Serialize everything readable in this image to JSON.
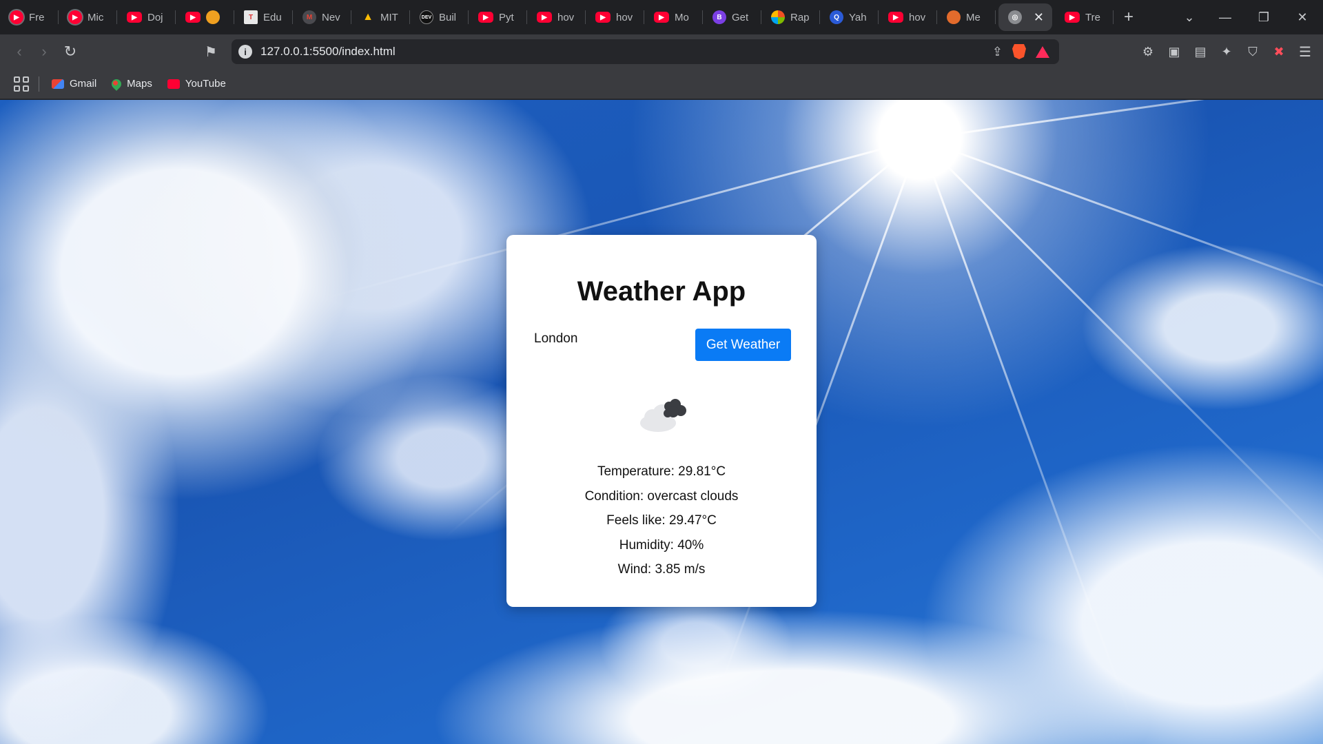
{
  "browser": {
    "tabs": [
      {
        "title": "Fre",
        "favicon": "youtube-icon"
      },
      {
        "title": "Mic",
        "favicon": "youtube-icon"
      },
      {
        "title": "Doj",
        "favicon": "youtube-icon"
      },
      {
        "title": "",
        "favicon": "youtube-icon"
      },
      {
        "title": "Edu",
        "favicon": "edu-icon"
      },
      {
        "title": "Nev",
        "favicon": "gmail-icon"
      },
      {
        "title": "MIT",
        "favicon": "drive-icon"
      },
      {
        "title": "Buil",
        "favicon": "dev-icon"
      },
      {
        "title": "Pyt",
        "favicon": "youtube-icon"
      },
      {
        "title": "hov",
        "favicon": "youtube-icon"
      },
      {
        "title": "hov",
        "favicon": "youtube-icon"
      },
      {
        "title": "Mo",
        "favicon": "youtube-icon"
      },
      {
        "title": "Get",
        "favicon": "b-icon"
      },
      {
        "title": "Rap",
        "favicon": "microsoft-icon"
      },
      {
        "title": "Yah",
        "favicon": "yahoo-icon"
      },
      {
        "title": "hov",
        "favicon": "youtube-icon"
      },
      {
        "title": "Me",
        "favicon": "meme-icon"
      },
      {
        "title": "",
        "favicon": "globe-icon",
        "active": true
      },
      {
        "title": "Tre",
        "favicon": "youtube-icon"
      }
    ],
    "address": {
      "url": "127.0.0.1:5500/index.html"
    },
    "bookmarks": [
      {
        "label": "Gmail",
        "icon": "gmail-icon"
      },
      {
        "label": "Maps",
        "icon": "maps-icon"
      },
      {
        "label": "YouTube",
        "icon": "youtube-icon"
      }
    ]
  },
  "app": {
    "title": "Weather App",
    "city_input": {
      "value": "London"
    },
    "get_button_label": "Get Weather",
    "weather_icon": "overcast-clouds-icon",
    "info": {
      "temperature": "Temperature: 29.81°C",
      "condition": "Condition: overcast clouds",
      "feels_like": "Feels like: 29.47°C",
      "humidity": "Humidity: 40%",
      "wind": "Wind: 3.85 m/s"
    }
  }
}
